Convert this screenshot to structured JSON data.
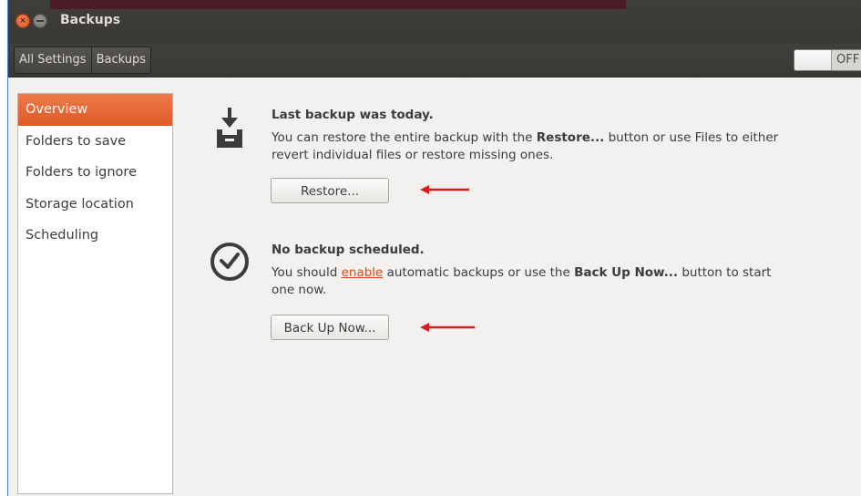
{
  "window": {
    "title": "Backups"
  },
  "toolbar": {
    "breadcrumbs": [
      "All Settings",
      "Backups"
    ],
    "toggle_label": "OFF"
  },
  "sidebar": {
    "items": [
      {
        "label": "Overview",
        "active": true
      },
      {
        "label": "Folders to save"
      },
      {
        "label": "Folders to ignore"
      },
      {
        "label": "Storage location"
      },
      {
        "label": "Scheduling"
      }
    ]
  },
  "main": {
    "backup": {
      "icon": "archive-download-icon",
      "heading": "Last backup was today.",
      "text_before": "You can restore the entire backup with the ",
      "text_bold": "Restore...",
      "text_after": " button or use Files to either revert individual files or restore missing ones.",
      "button": "Restore..."
    },
    "schedule": {
      "icon": "clock-icon",
      "heading": "No backup scheduled.",
      "text_before": "You should ",
      "link": "enable",
      "text_middle": " automatic backups or use the ",
      "text_bold": "Back Up Now...",
      "text_after": " button to start one now.",
      "button": "Back Up Now..."
    }
  },
  "colors": {
    "accent": "#dd4814",
    "annotation_arrow": "#d81b1b",
    "titlebar": "#3c3b37"
  }
}
